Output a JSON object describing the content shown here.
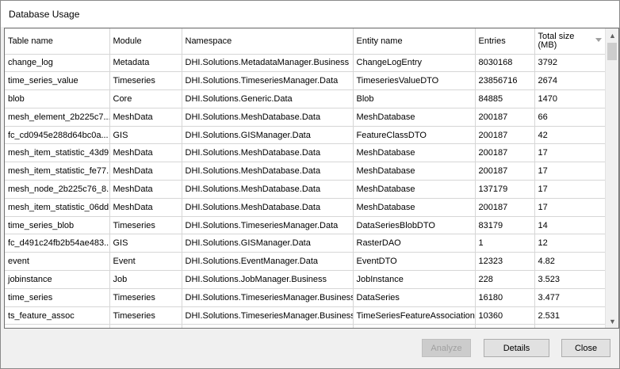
{
  "window": {
    "title": "Database Usage"
  },
  "table": {
    "columns": [
      "Table name",
      "Module",
      "Namespace",
      "Entity name",
      "Entries",
      "Total size\n(MB)"
    ],
    "rows": [
      [
        "change_log",
        "Metadata",
        "DHI.Solutions.MetadataManager.Business",
        "ChangeLogEntry",
        "8030168",
        "3792"
      ],
      [
        "time_series_value",
        "Timeseries",
        "DHI.Solutions.TimeseriesManager.Data",
        "TimeseriesValueDTO",
        "23856716",
        "2674"
      ],
      [
        "blob",
        "Core",
        "DHI.Solutions.Generic.Data",
        "Blob",
        "84885",
        "1470"
      ],
      [
        "mesh_element_2b225c7...",
        "MeshData",
        "DHI.Solutions.MeshDatabase.Data",
        "MeshDatabase",
        "200187",
        "66"
      ],
      [
        "fc_cd0945e288d64bc0a...",
        "GIS",
        "DHI.Solutions.GISManager.Data",
        "FeatureClassDTO",
        "200187",
        "42"
      ],
      [
        "mesh_item_statistic_43d9...",
        "MeshData",
        "DHI.Solutions.MeshDatabase.Data",
        "MeshDatabase",
        "200187",
        "17"
      ],
      [
        "mesh_item_statistic_fe77...",
        "MeshData",
        "DHI.Solutions.MeshDatabase.Data",
        "MeshDatabase",
        "200187",
        "17"
      ],
      [
        "mesh_node_2b225c76_8...",
        "MeshData",
        "DHI.Solutions.MeshDatabase.Data",
        "MeshDatabase",
        "137179",
        "17"
      ],
      [
        "mesh_item_statistic_06dd...",
        "MeshData",
        "DHI.Solutions.MeshDatabase.Data",
        "MeshDatabase",
        "200187",
        "17"
      ],
      [
        "time_series_blob",
        "Timeseries",
        "DHI.Solutions.TimeseriesManager.Data",
        "DataSeriesBlobDTO",
        "83179",
        "14"
      ],
      [
        "fc_d491c24fb2b54ae483...",
        "GIS",
        "DHI.Solutions.GISManager.Data",
        "RasterDAO",
        "1",
        "12"
      ],
      [
        "event",
        "Event",
        "DHI.Solutions.EventManager.Data",
        "EventDTO",
        "12323",
        "4.82"
      ],
      [
        "jobinstance",
        "Job",
        "DHI.Solutions.JobManager.Business",
        "JobInstance",
        "228",
        "3.523"
      ],
      [
        "time_series",
        "Timeseries",
        "DHI.Solutions.TimeseriesManager.Business",
        "DataSeries",
        "16180",
        "3.477"
      ],
      [
        "ts_feature_assoc",
        "Timeseries",
        "DHI.Solutions.TimeseriesManager.Business",
        "TimeSeriesFeatureAssociation",
        "10360",
        "2.531"
      ],
      [
        "",
        "",
        "",
        "",
        "",
        ""
      ]
    ]
  },
  "icons": {
    "sort": "sort-descending-icon",
    "scroll_up": "arrow-up-icon",
    "scroll_down": "arrow-down-icon"
  },
  "buttons": {
    "analyze": "Analyze",
    "details": "Details",
    "close": "Close"
  }
}
